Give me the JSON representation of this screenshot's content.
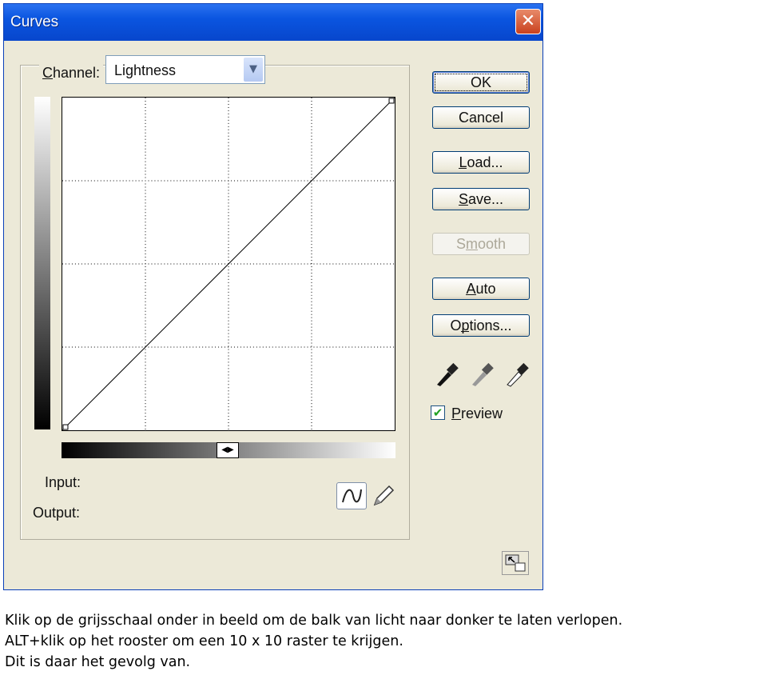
{
  "window": {
    "title": "Curves",
    "close_icon": "close-icon"
  },
  "channel": {
    "label": "Channel:",
    "mnemonic": "C",
    "value": "Lightness"
  },
  "graph": {
    "grid_divisions": 4,
    "curve_points": [
      [
        0,
        0
      ],
      [
        255,
        255
      ]
    ]
  },
  "readout": {
    "input_label": "Input:",
    "output_label": "Output:"
  },
  "buttons": [
    {
      "label": "OK",
      "mnemonic": ""
    },
    {
      "label": "Cancel",
      "mnemonic": ""
    },
    {
      "label": "Load...",
      "mnemonic": "L"
    },
    {
      "label": "Save...",
      "mnemonic": "S"
    },
    {
      "label": "Smooth",
      "mnemonic": "m",
      "disabled": true
    },
    {
      "label": "Auto",
      "mnemonic": "A"
    },
    {
      "label": "Options...",
      "mnemonic": "p"
    }
  ],
  "preview": {
    "label": "Preview",
    "mnemonic": "P",
    "checked": true
  },
  "caption": [
    "Klik op de grijsschaal onder in beeld om de balk van licht naar donker te laten verlopen.",
    "ALT+klik op het rooster om een 10 x 10 raster te krijgen.",
    "Dit is daar het gevolg van."
  ]
}
